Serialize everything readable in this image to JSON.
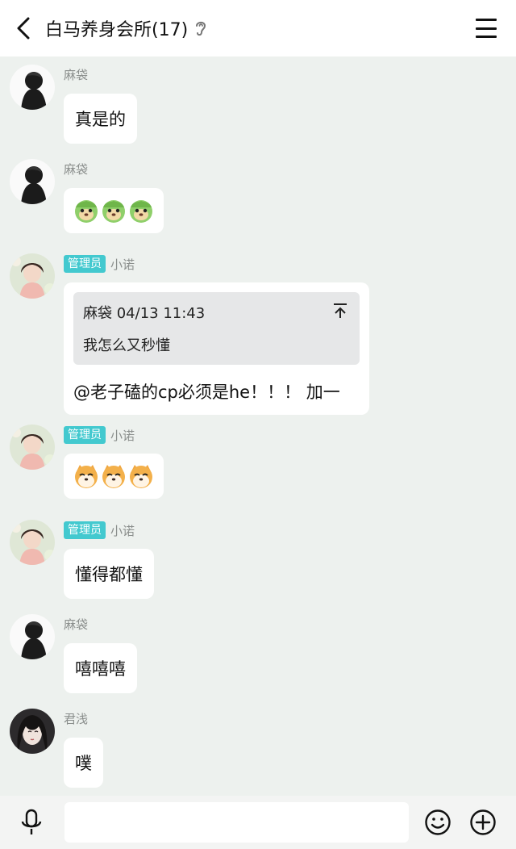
{
  "header": {
    "title": "白马养身会所(17)",
    "back_icon": "chevron-left-icon",
    "mode_icon": "ear-icon",
    "menu_icon": "menu-icon"
  },
  "messages": [
    {
      "sender": "麻袋",
      "text": "真是的"
    },
    {
      "sender": "麻袋",
      "emoji": [
        "cabbage-dog-emoji",
        "cabbage-dog-emoji",
        "cabbage-dog-emoji"
      ]
    },
    {
      "sender": "小诺",
      "badge": "管理员",
      "quote": {
        "header": "麻袋 04/13 11:43",
        "text": "我怎么又秒懂"
      },
      "text": "@老子磕的cp必须是he！！！ 加一"
    },
    {
      "sender": "小诺",
      "badge": "管理员",
      "emoji": [
        "shiba-emoji",
        "shiba-emoji",
        "shiba-emoji"
      ]
    },
    {
      "sender": "小诺",
      "badge": "管理员",
      "text": "懂得都懂"
    },
    {
      "sender": "麻袋",
      "text": "嘻嘻嘻"
    },
    {
      "sender": "君浅",
      "text": "噗"
    }
  ],
  "input_bar": {
    "voice_icon": "microphone-icon",
    "input_value": "",
    "emoji_icon": "smiley-icon",
    "plus_icon": "plus-circle-icon"
  },
  "colors": {
    "background": "#edf1ee",
    "badge": "#43c9cf",
    "bubble": "#ffffff",
    "quote": "#e6e7e8"
  }
}
